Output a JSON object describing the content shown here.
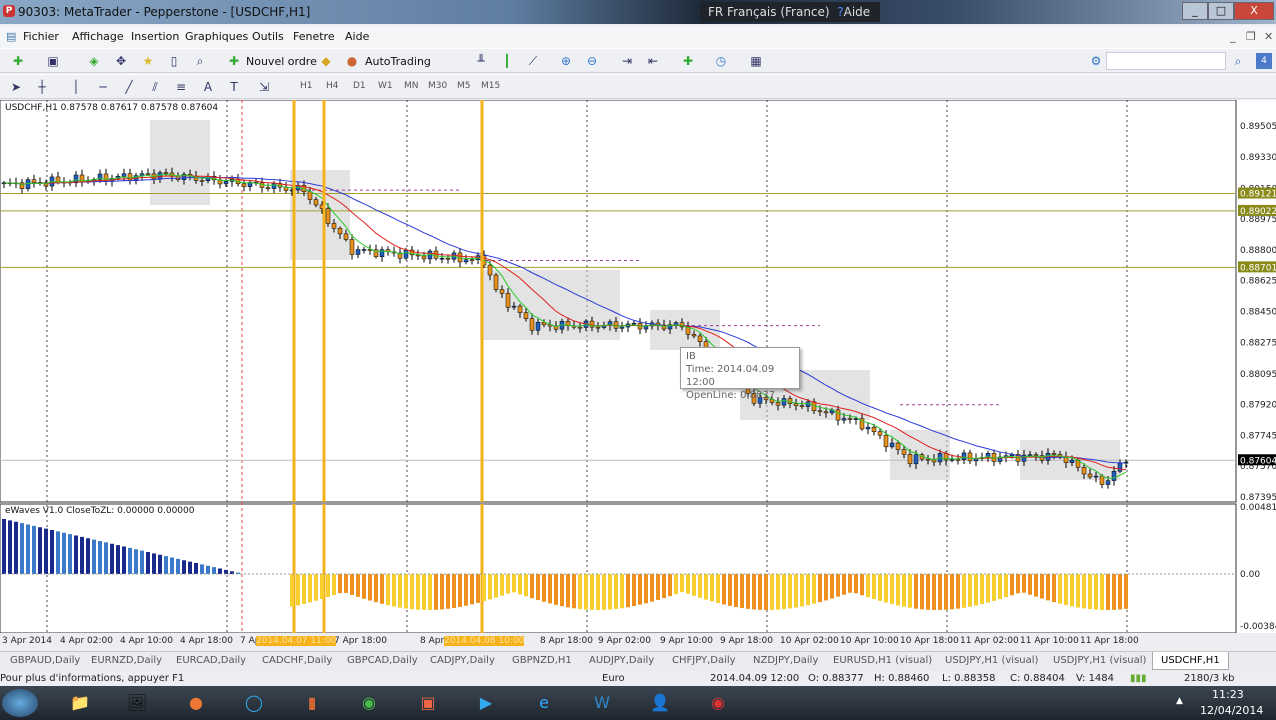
{
  "window": {
    "title": "90303: MetaTrader - Pepperstone - [USDCHF,H1]",
    "language": "FR Français (France)",
    "help": "Aide",
    "min": "_",
    "max": "□",
    "close": "X"
  },
  "menu": [
    "Fichier",
    "Affichage",
    "Insertion",
    "Graphiques",
    "Outils",
    "Fenetre",
    "Aide"
  ],
  "toolbar": {
    "new_order": "Nouvel ordre",
    "autotrading": "AutoTrading",
    "text_tool": "A",
    "timeframes": [
      "H1",
      "H4",
      "D1",
      "W1",
      "MN",
      "M30",
      "M5",
      "M15"
    ]
  },
  "chart": {
    "header": "USDCHF,H1  0.87578 0.87617 0.87578 0.87604",
    "indicator_header": "eWaves V1.0 CloseToZL: 0.00000 0.00000",
    "price_ticks": [
      "0.89505",
      "0.89330",
      "0.89150",
      "0.88975",
      "0.88800",
      "0.88625",
      "0.88450",
      "0.88275",
      "0.88095",
      "0.87920",
      "0.87745",
      "0.87570",
      "0.87395"
    ],
    "price_labels": [
      {
        "text": "0.89121",
        "color": "#8a8a1a"
      },
      {
        "text": "0.89022",
        "color": "#8a8a1a"
      },
      {
        "text": "0.88701",
        "color": "#8a8a1a"
      },
      {
        "text": "0.87604",
        "color": "#000000"
      }
    ],
    "indicator_ticks": [
      "0.004812",
      "0.00",
      "-0.003841"
    ],
    "time_labels": [
      "3 Apr 2014",
      "4 Apr 02:00",
      "4 Apr 10:00",
      "4 Apr 18:00",
      "7 Apr",
      "7 Apr 18:00",
      "8 Apr",
      "8 Apr 18:00",
      "9 Apr 02:00",
      "9 Apr 10:00",
      "9 Apr 18:00",
      "10 Apr 02:00",
      "10 Apr 10:00",
      "10 Apr 18:00",
      "11 Apr 02:00",
      "11 Apr 10:00",
      "11 Apr 18:00"
    ],
    "highlight_times": [
      "2014.04.07 11:00",
      "2014.04.08 10:00"
    ],
    "price_path": [
      [
        0,
        0.8917
      ],
      [
        26,
        0.8923
      ],
      [
        50,
        0.8914
      ],
      [
        58,
        0.888
      ],
      [
        80,
        0.8874
      ],
      [
        82,
        0.8857
      ],
      [
        88,
        0.8837
      ],
      [
        113,
        0.8837
      ],
      [
        125,
        0.8795
      ],
      [
        133,
        0.8792
      ],
      [
        143,
        0.8781
      ],
      [
        151,
        0.8761
      ],
      [
        176,
        0.8763
      ],
      [
        183,
        0.8747
      ],
      [
        187,
        0.87604
      ]
    ],
    "colors": {
      "bull": "#1f5fbf",
      "bear": "#e8901c",
      "ma_slow": "#2a3bd8",
      "ma_mid": "#e0201c",
      "ma_fast": "#28c828",
      "vline": "#f5b21a"
    }
  },
  "tooltip": {
    "name": "IB",
    "time": "Time: 2014.04.09 12:00",
    "open": "OpenLine: 0.8837"
  },
  "tabs": [
    "GBPAUD,Daily",
    "EURNZD,Daily",
    "EURCAD,Daily",
    "CADCHF,Daily",
    "GBPCAD,Daily",
    "CADJPY,Daily",
    "GBPNZD,H1",
    "AUDJPY,Daily",
    "CHFJPY,Daily",
    "NZDJPY,Daily",
    "EURUSD,H1 (visual)",
    "USDJPY,H1 (visual)",
    "USDJPY,H1 (visual)",
    "USDCHF,H1"
  ],
  "status": {
    "help": "Pour plus d'informations, appuyer F1",
    "profile": "Euro",
    "time": "2014.04.09 12:00",
    "open": "O: 0.88377",
    "high": "H: 0.88460",
    "low": "L: 0.88358",
    "close": "C: 0.88404",
    "volume": "V: 1484",
    "traffic": "2180/3 kb"
  },
  "taskbar": {
    "clock": "11:23",
    "date": "12/04/2014"
  }
}
